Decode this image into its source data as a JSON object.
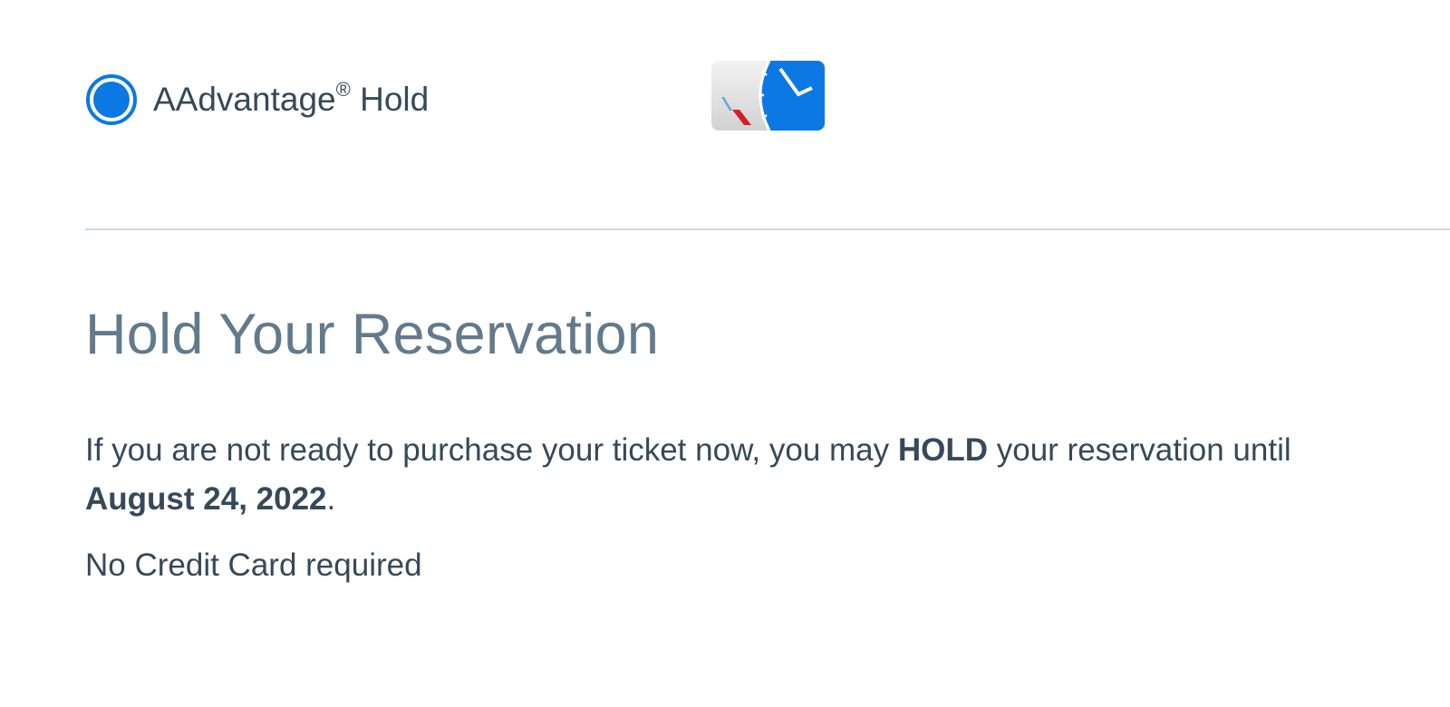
{
  "hold_option": {
    "label_main": "AAdvantage",
    "label_mark": "®",
    "label_tail": " Hold",
    "selected": true,
    "icon": "aa-hold-clock-icon"
  },
  "section": {
    "title": "Hold Your Reservation",
    "description": {
      "part1": "If you are not ready to purchase your ticket now, you may ",
      "hold_word": "HOLD",
      "part2": " your reservation until ",
      "date": "August 24, 2022",
      "part3": "."
    },
    "note": "No Credit Card required"
  },
  "colors": {
    "accent": "#0b78e3",
    "title": "#627a8c",
    "text": "#36495a",
    "divider": "#d0d8de"
  }
}
